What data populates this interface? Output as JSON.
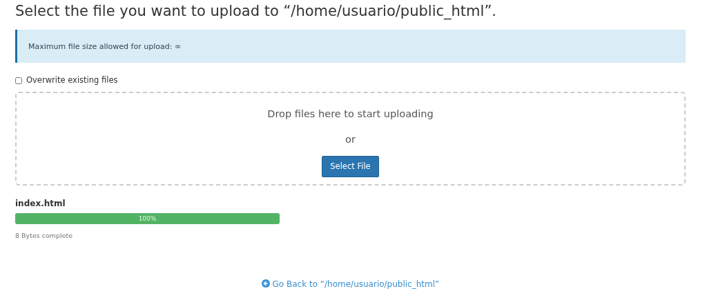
{
  "heading": "Select the file you want to upload to “/home/usuario/public_html”.",
  "notice": "Maximum file size allowed for upload: ∞",
  "overwrite": {
    "label": "Overwrite existing files",
    "checked": false
  },
  "dropzone": {
    "prompt": "Drop files here to start uploading",
    "separator": "or",
    "button": "Select File"
  },
  "uploads": [
    {
      "filename": "index.html",
      "level": 1,
      "reading": "100%",
      "status": "8 Bytes complete"
    }
  ],
  "back_link": "Go Back to “/home/usuario/public_html”"
}
